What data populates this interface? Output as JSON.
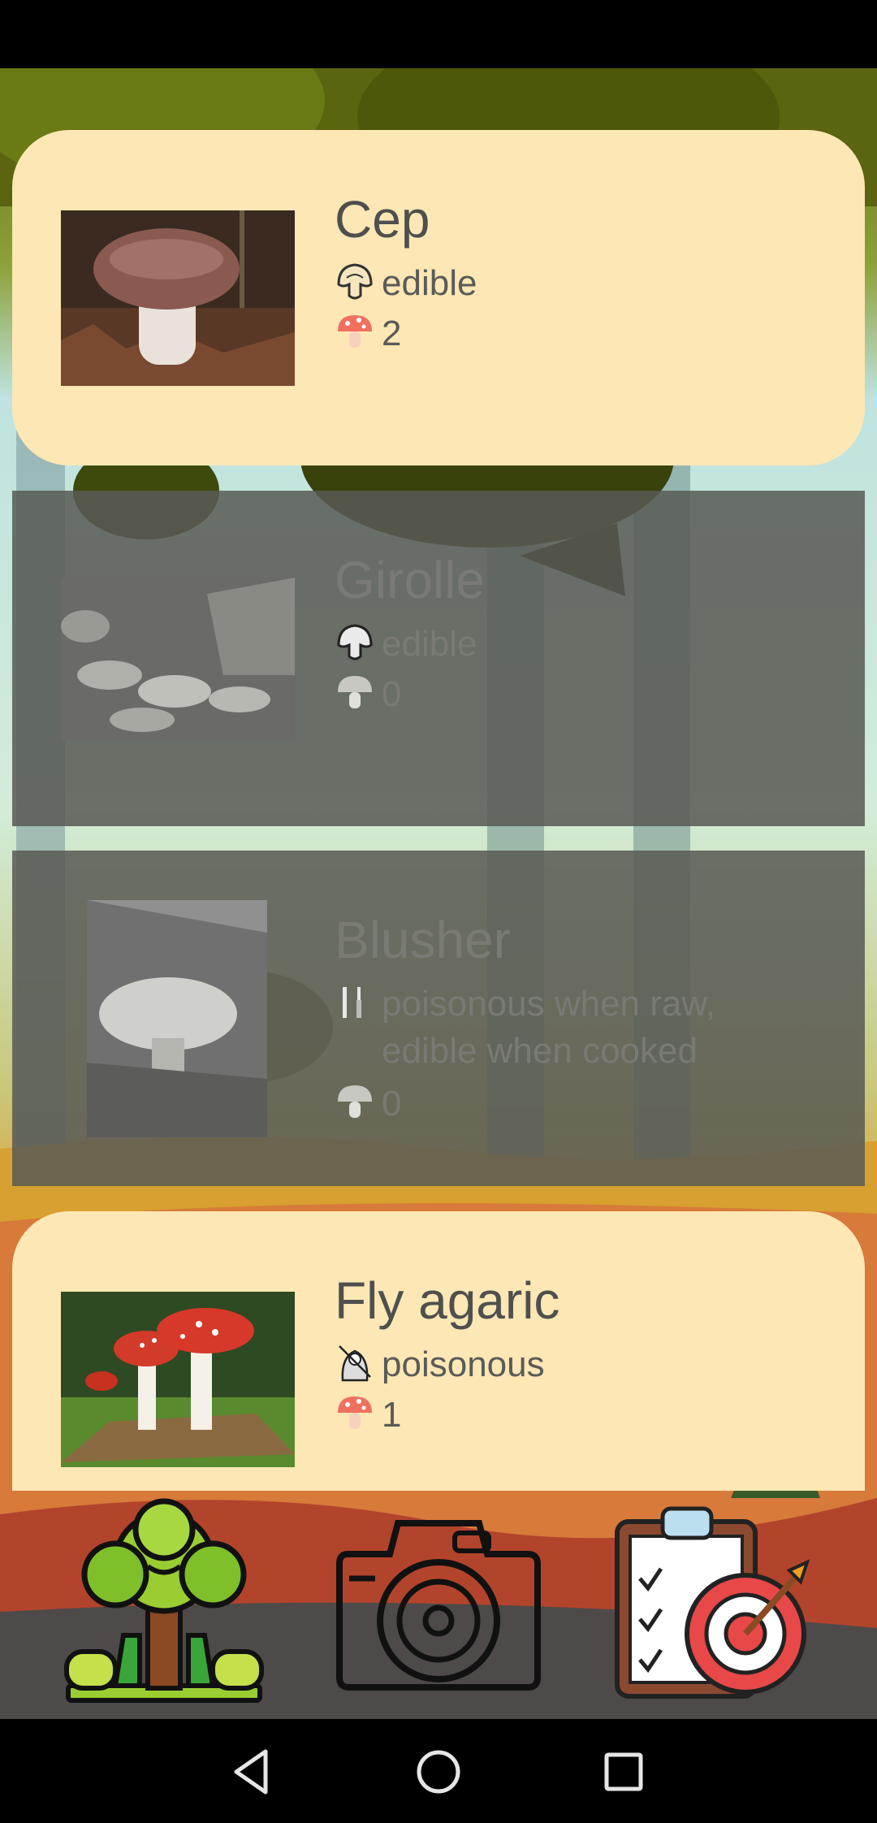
{
  "mushrooms": [
    {
      "name": "Cep",
      "edibility": "edible",
      "edibility_icon": "mushroom-slice-icon",
      "count": "2",
      "found": true
    },
    {
      "name": "Girolle",
      "edibility": "edible",
      "edibility_icon": "mushroom-slice-icon",
      "count": "0",
      "found": false
    },
    {
      "name": "Blusher",
      "edibility_line1": "poisonous when raw,",
      "edibility_line2": "edible when cooked",
      "edibility_icon": "knife-fork-icon",
      "count": "0",
      "found": false
    },
    {
      "name": "Fly agaric",
      "edibility": "poisonous",
      "edibility_icon": "grim-reaper-icon",
      "count": "1",
      "found": true
    }
  ],
  "bottom_nav": [
    "forest-icon",
    "camera-icon",
    "goals-clipboard-icon"
  ],
  "colors": {
    "card": "#fde7b4",
    "locked_overlay": "#585a54",
    "text": "#4f4f4f",
    "count_icon": "#f07060"
  }
}
